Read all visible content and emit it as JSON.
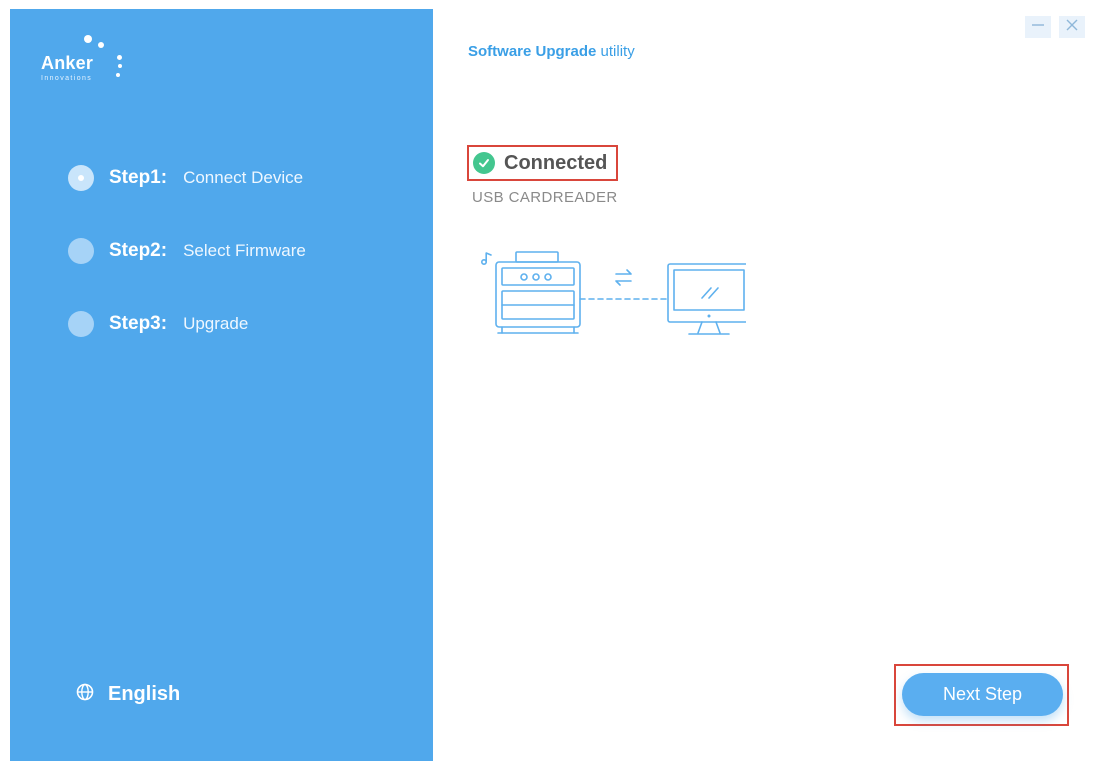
{
  "brand": {
    "name": "Anker",
    "subtitle": "Innovations"
  },
  "header": {
    "title_strong": "Software Upgrade",
    "title_rest": "utility"
  },
  "window_controls": {
    "minimize_icon": "minimize-icon",
    "close_icon": "close-icon"
  },
  "steps": [
    {
      "number": "Step1:",
      "label": "Connect Device",
      "state": "active"
    },
    {
      "number": "Step2:",
      "label": "Select Firmware",
      "state": "pending"
    },
    {
      "number": "Step3:",
      "label": "Upgrade",
      "state": "pending"
    }
  ],
  "language": {
    "icon": "globe-icon",
    "label": "English"
  },
  "device": {
    "status": "Connected",
    "name": "USB CARDREADER"
  },
  "actions": {
    "next_label": "Next Step"
  },
  "colors": {
    "sidebar": "#50a8ec",
    "accent": "#5aaef0",
    "success": "#43c68f",
    "highlight": "#d9463b"
  }
}
